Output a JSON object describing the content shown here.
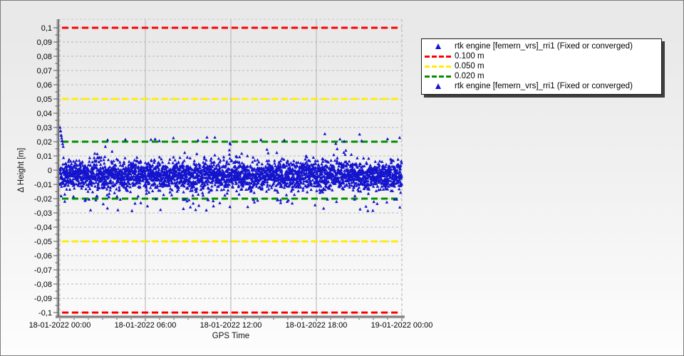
{
  "window": {
    "bg_top": "#e9e9e9",
    "bg_bottom": "#fdfdfd",
    "border_color": "#7d7d7d"
  },
  "legend": {
    "entries": [
      {
        "type": "marker",
        "color": "#1414cc",
        "label": "rtk engine [femern_vrs]_rri1 (Fixed or converged)"
      },
      {
        "type": "dash",
        "color": "#ff0000",
        "label": "0.100 m"
      },
      {
        "type": "dash",
        "color": "#ffee00",
        "label": "0.050 m"
      },
      {
        "type": "dash",
        "color": "#009000",
        "label": "0.020 m"
      },
      {
        "type": "marker",
        "color": "#1414cc",
        "label": "rtk engine [femern_vrs]_rri1 (Fixed or converged)"
      }
    ]
  },
  "chart_data": {
    "type": "scatter",
    "title": "",
    "xlabel": "GPS Time",
    "ylabel": "Δ Height [m]",
    "xlim_hours": [
      0,
      24
    ],
    "ylim": [
      -0.1025,
      0.106
    ],
    "grid": {
      "h_color": "#b8b8b8",
      "v_color": "#b3b3b3",
      "axis_color": "#9a9a9a",
      "axis_dark": "#555555"
    },
    "x_ticks": [
      {
        "label": "18-01-2022 00:00",
        "h": 0
      },
      {
        "label": "18-01-2022 06:00",
        "h": 6
      },
      {
        "label": "18-01-2022 12:00",
        "h": 12
      },
      {
        "label": "18-01-2022 18:00",
        "h": 18
      },
      {
        "label": "19-01-2022 00:00",
        "h": 24
      }
    ],
    "y_ticks": [
      {
        "label": "0,1",
        "v": 0.1
      },
      {
        "label": "0,09",
        "v": 0.09
      },
      {
        "label": "0,08",
        "v": 0.08
      },
      {
        "label": "0,07",
        "v": 0.07
      },
      {
        "label": "0,06",
        "v": 0.06
      },
      {
        "label": "0,05",
        "v": 0.05
      },
      {
        "label": "0,04",
        "v": 0.04
      },
      {
        "label": "0,03",
        "v": 0.03
      },
      {
        "label": "0,02",
        "v": 0.02
      },
      {
        "label": "0,01",
        "v": 0.01
      },
      {
        "label": "0",
        "v": 0
      },
      {
        "label": "-0,01",
        "v": -0.01
      },
      {
        "label": "-0,02",
        "v": -0.02
      },
      {
        "label": "-0,03",
        "v": -0.03
      },
      {
        "label": "-0,04",
        "v": -0.04
      },
      {
        "label": "-0,05",
        "v": -0.05
      },
      {
        "label": "-0,06",
        "v": -0.06
      },
      {
        "label": "-0,07",
        "v": -0.07
      },
      {
        "label": "-0,08",
        "v": -0.08
      },
      {
        "label": "-0,09",
        "v": -0.09
      },
      {
        "label": "-0,1",
        "v": -0.1
      }
    ],
    "reference_levels": [
      {
        "label": "0.100 m",
        "value": 0.1,
        "color": "#ff0000",
        "mirrored": true
      },
      {
        "label": "0.050 m",
        "value": 0.05,
        "color": "#ffee00",
        "mirrored": true
      },
      {
        "label": "0.020 m",
        "value": 0.02,
        "color": "#009000",
        "mirrored": true
      }
    ],
    "series": [
      {
        "name": "rtk engine [femern_vrs]_rri1 (Fixed or converged)",
        "marker": "triangle",
        "color": "#1414cd",
        "summary": "Dense height residuals around 0 m, core band roughly -0.018 to +0.012 m, recurring peaks touching ±0.02 m, sparse outliers down to -0.029 m and a start-of-day spike up to +0.031 m",
        "generator": {
          "seed": 1337,
          "n": 3200,
          "hours": 24,
          "mean": -0.0035,
          "sigma": 0.0052,
          "clamp": [
            -0.0208,
            0.0242
          ],
          "pos_peak_gain": 1.15,
          "neg_dip_gain": 0.3,
          "peak_waves": [
            [
              0.82,
              4.9,
              0.55
            ],
            [
              2.23,
              1.1,
              0.45
            ],
            [
              4.9,
              0.35,
              0.38
            ],
            [
              9.4,
              2.0,
              0.3
            ]
          ],
          "peak_bias": -0.55,
          "peak_scale": 1.4,
          "dip_waves": [
            [
              0.65,
              2.2,
              0.5
            ],
            [
              3.1,
              0.8,
              0.5
            ]
          ],
          "dip_bias": -0.45,
          "dip_scale": 1.3,
          "low_outliers": {
            "count": 55,
            "y_min": -0.0288,
            "y_max": -0.0205
          },
          "high_outliers": {
            "count": 16,
            "y_min": 0.0205,
            "y_max": 0.0258
          },
          "start_spike": {
            "count": 10,
            "t_max": 0.25,
            "y_min": 0.016,
            "y_max": 0.031
          }
        }
      }
    ]
  }
}
